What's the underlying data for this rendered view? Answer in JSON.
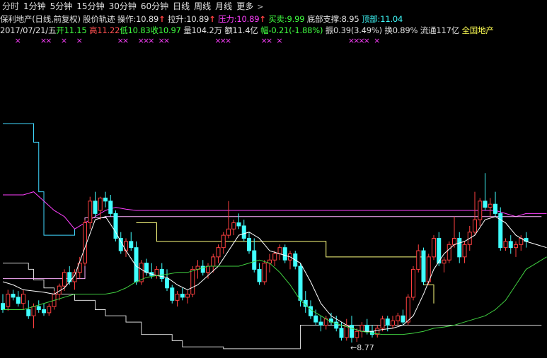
{
  "toolbar": {
    "periods": [
      "分时",
      "1分钟",
      "5分钟",
      "15分钟",
      "30分钟",
      "60分钟",
      "日线",
      "周线",
      "月线"
    ],
    "more_label": "更多",
    "more_arrow": ">"
  },
  "indicator": {
    "title": "保利地产(日线,前复权) 股价轨迹",
    "op_label": "操作:",
    "op_value": "10.89",
    "pull_label": "拉升:",
    "pull_value": "10.89",
    "pressure_label": "压力:",
    "pressure_value": "10.89",
    "buysell_label": "买卖:",
    "buysell_value": "9.99",
    "support_label": "底部支撑:",
    "support_value": "8.95",
    "top_label": "顶部:",
    "top_value": "11.04",
    "arrow": "↑"
  },
  "quote": {
    "date": "2017/07/21/五",
    "open_label": "开",
    "open": "11.15",
    "high_label": "高",
    "high": "11.22",
    "low_label": "低",
    "low": "10.83",
    "close_label": "收",
    "close": "10.97",
    "vol_label": "量",
    "vol": "104.2万",
    "amount_label": "额",
    "amount": "11.4亿",
    "change_label": "幅",
    "change": "-0.21(-1.88%)",
    "amp_label": "振",
    "amp": "0.39(3.49%)",
    "turnover_label": "换",
    "turnover": "0.89%",
    "float_label": "流通",
    "float": "117亿",
    "name": "全国地产"
  },
  "marker_glyph": "×",
  "annotation": {
    "low_text": "←8.77"
  },
  "colors": {
    "up": "#ff4040",
    "down": "#40ffff",
    "cyan_line": "#40d8ff",
    "magenta": "#ff40ff",
    "yellow": "#ffff80",
    "green": "#40d040",
    "white": "#ffffff",
    "support": "#d8d8d8",
    "resistance": "#ffb0ff"
  },
  "chart_data": {
    "type": "candlestick",
    "price_range": [
      8.6,
      12.3
    ],
    "candles": [
      [
        9.4,
        9.55,
        9.25,
        9.3
      ],
      [
        9.35,
        9.62,
        9.28,
        9.55
      ],
      [
        9.55,
        9.62,
        9.45,
        9.5
      ],
      [
        9.5,
        9.6,
        9.35,
        9.4
      ],
      [
        9.4,
        9.62,
        9.3,
        9.55
      ],
      [
        9.3,
        9.45,
        9.15,
        9.2
      ],
      [
        9.2,
        9.4,
        9.0,
        9.35
      ],
      [
        9.35,
        9.45,
        9.25,
        9.3
      ],
      [
        9.3,
        9.4,
        9.2,
        9.25
      ],
      [
        9.25,
        9.4,
        9.2,
        9.35
      ],
      [
        9.35,
        9.6,
        9.3,
        9.55
      ],
      [
        9.55,
        9.72,
        9.45,
        9.68
      ],
      [
        9.68,
        9.95,
        9.6,
        9.9
      ],
      [
        9.9,
        10.0,
        9.7,
        9.75
      ],
      [
        9.75,
        9.95,
        9.62,
        9.9
      ],
      [
        9.9,
        10.15,
        9.8,
        10.05
      ],
      [
        10.05,
        10.75,
        10.0,
        10.7
      ],
      [
        10.7,
        11.12,
        10.6,
        11.05
      ],
      [
        11.05,
        11.2,
        10.8,
        10.85
      ],
      [
        10.9,
        11.12,
        10.75,
        11.1
      ],
      [
        11.1,
        11.2,
        10.95,
        11.05
      ],
      [
        11.05,
        11.15,
        10.8,
        10.85
      ],
      [
        10.85,
        10.9,
        10.4,
        10.45
      ],
      [
        10.45,
        10.55,
        10.2,
        10.25
      ],
      [
        10.25,
        10.45,
        10.15,
        10.4
      ],
      [
        10.4,
        10.55,
        10.25,
        10.3
      ],
      [
        10.3,
        10.4,
        9.7,
        9.75
      ],
      [
        9.75,
        10.1,
        9.7,
        10.05
      ],
      [
        10.05,
        10.12,
        9.85,
        9.9
      ],
      [
        9.9,
        10.05,
        9.8,
        9.85
      ],
      [
        9.85,
        10.0,
        9.8,
        9.95
      ],
      [
        9.95,
        10.05,
        9.75,
        9.8
      ],
      [
        9.8,
        9.95,
        9.6,
        9.65
      ],
      [
        9.65,
        9.7,
        9.4,
        9.45
      ],
      [
        9.45,
        9.6,
        9.35,
        9.55
      ],
      [
        9.55,
        9.65,
        9.45,
        9.5
      ],
      [
        9.5,
        9.62,
        9.4,
        9.55
      ],
      [
        9.55,
        10.0,
        9.5,
        9.95
      ],
      [
        9.95,
        10.1,
        9.8,
        10.0
      ],
      [
        10.0,
        10.1,
        9.85,
        9.9
      ],
      [
        9.9,
        10.05,
        9.8,
        10.0
      ],
      [
        10.0,
        10.2,
        9.9,
        10.15
      ],
      [
        10.15,
        10.35,
        10.05,
        10.3
      ],
      [
        10.3,
        10.55,
        10.2,
        10.5
      ],
      [
        10.5,
        11.05,
        10.45,
        10.6
      ],
      [
        10.6,
        10.75,
        10.5,
        10.7
      ],
      [
        10.7,
        10.85,
        10.6,
        10.65
      ],
      [
        10.65,
        10.75,
        10.4,
        10.45
      ],
      [
        10.45,
        10.55,
        10.2,
        10.25
      ],
      [
        10.25,
        10.45,
        9.9,
        9.95
      ],
      [
        9.95,
        10.05,
        9.7,
        9.75
      ],
      [
        9.75,
        10.1,
        9.7,
        10.05
      ],
      [
        10.05,
        10.2,
        9.9,
        10.1
      ],
      [
        10.1,
        10.25,
        10.0,
        10.2
      ],
      [
        10.2,
        10.35,
        10.1,
        10.3
      ],
      [
        10.3,
        10.35,
        10.05,
        10.1
      ],
      [
        10.1,
        10.25,
        9.95,
        10.2
      ],
      [
        10.2,
        10.25,
        9.95,
        10.0
      ],
      [
        10.0,
        10.05,
        9.35,
        9.45
      ],
      [
        9.45,
        9.6,
        9.25,
        9.35
      ],
      [
        9.35,
        9.45,
        9.15,
        9.2
      ],
      [
        9.2,
        9.3,
        9.05,
        9.1
      ],
      [
        9.1,
        9.2,
        8.95,
        9.05
      ],
      [
        9.05,
        9.2,
        8.98,
        9.15
      ],
      [
        9.15,
        9.25,
        9.05,
        9.1
      ],
      [
        9.1,
        9.2,
        8.95,
        9.0
      ],
      [
        9.0,
        9.1,
        8.8,
        8.85
      ],
      [
        8.85,
        9.15,
        8.8,
        9.05
      ],
      [
        9.05,
        9.2,
        8.77,
        8.85
      ],
      [
        8.85,
        9.0,
        8.78,
        8.95
      ],
      [
        8.95,
        9.1,
        8.85,
        9.05
      ],
      [
        9.05,
        9.15,
        8.9,
        8.95
      ],
      [
        8.95,
        9.05,
        8.85,
        8.9
      ],
      [
        8.9,
        9.05,
        8.85,
        9.0
      ],
      [
        9.0,
        9.2,
        8.95,
        9.15
      ],
      [
        9.15,
        9.2,
        8.95,
        9.05
      ],
      [
        9.05,
        9.2,
        9.0,
        9.12
      ],
      [
        9.12,
        9.25,
        9.05,
        9.2
      ],
      [
        9.2,
        9.3,
        9.05,
        9.1
      ],
      [
        9.1,
        9.55,
        9.05,
        9.5
      ],
      [
        9.5,
        10.0,
        9.45,
        9.95
      ],
      [
        9.95,
        10.35,
        9.9,
        10.25
      ],
      [
        10.25,
        10.3,
        9.7,
        9.75
      ],
      [
        9.75,
        10.2,
        9.7,
        10.15
      ],
      [
        10.15,
        10.5,
        10.1,
        10.45
      ],
      [
        10.45,
        10.55,
        10.0,
        10.05
      ],
      [
        10.05,
        10.15,
        9.9,
        10.1
      ],
      [
        10.1,
        10.4,
        10.05,
        10.35
      ],
      [
        10.35,
        10.8,
        10.3,
        10.45
      ],
      [
        10.45,
        10.55,
        10.05,
        10.15
      ],
      [
        10.15,
        10.4,
        10.05,
        10.35
      ],
      [
        10.35,
        10.65,
        10.25,
        10.55
      ],
      [
        10.55,
        11.2,
        10.5,
        10.75
      ],
      [
        10.75,
        11.1,
        10.65,
        11.05
      ],
      [
        11.05,
        11.5,
        10.9,
        10.95
      ],
      [
        10.95,
        11.1,
        10.8,
        11.0
      ],
      [
        11.0,
        11.2,
        10.8,
        10.85
      ],
      [
        10.85,
        10.95,
        10.25,
        10.3
      ],
      [
        10.3,
        10.45,
        10.25,
        10.4
      ],
      [
        10.4,
        10.5,
        10.2,
        10.3
      ],
      [
        10.3,
        10.4,
        10.15,
        10.35
      ],
      [
        10.35,
        10.5,
        10.25,
        10.45
      ],
      [
        10.45,
        10.55,
        10.3,
        10.4
      ]
    ],
    "lines": {
      "support": [
        [
          0,
          10.05
        ],
        [
          4,
          10.05
        ],
        [
          5,
          9.95
        ],
        [
          6,
          9.78
        ],
        [
          8,
          9.65
        ],
        [
          10,
          9.55
        ],
        [
          14,
          9.45
        ],
        [
          18,
          9.3
        ],
        [
          20,
          9.2
        ],
        [
          24,
          9.1
        ],
        [
          27,
          8.9
        ],
        [
          33,
          8.8
        ],
        [
          34,
          8.8
        ],
        [
          35,
          8.7
        ],
        [
          36,
          8.7
        ],
        [
          40,
          8.7
        ],
        [
          43,
          8.67
        ],
        [
          44,
          8.67
        ],
        [
          45,
          8.67
        ],
        [
          47,
          8.67
        ],
        [
          48,
          8.67
        ],
        [
          49,
          8.67
        ],
        [
          52,
          8.67
        ],
        [
          53,
          8.67
        ],
        [
          55,
          8.67
        ],
        [
          57,
          8.67
        ],
        [
          58,
          9.05
        ],
        [
          62,
          9.05
        ],
        [
          69,
          9.05
        ],
        [
          80,
          9.05
        ],
        [
          90,
          9.05
        ],
        [
          100,
          9.05
        ],
        [
          103,
          9.05
        ],
        [
          105,
          9.05
        ]
      ],
      "upper": [
        [
          26,
          10.7
        ],
        [
          30,
          10.4
        ],
        [
          34,
          10.4
        ],
        [
          36,
          10.4
        ],
        [
          40,
          10.4
        ],
        [
          44,
          10.4
        ],
        [
          48,
          10.4
        ],
        [
          52,
          10.4
        ],
        [
          56,
          10.4
        ],
        [
          60,
          10.4
        ],
        [
          63,
          10.15
        ],
        [
          64,
          10.15
        ],
        [
          68,
          10.15
        ],
        [
          72,
          10.15
        ],
        [
          76,
          10.15
        ],
        [
          80,
          10.15
        ],
        [
          82,
          9.7
        ],
        [
          84,
          9.4
        ]
      ],
      "resistance": [
        [
          0,
          9.8
        ],
        [
          12,
          9.8
        ],
        [
          14,
          9.8
        ],
        [
          16,
          10.78
        ],
        [
          20,
          10.8
        ],
        [
          30,
          10.8
        ],
        [
          40,
          10.8
        ],
        [
          50,
          10.8
        ],
        [
          60,
          10.8
        ],
        [
          70,
          10.8
        ],
        [
          80,
          10.8
        ],
        [
          90,
          10.8
        ],
        [
          100,
          10.8
        ],
        [
          105,
          10.8
        ]
      ],
      "magenta": [
        [
          0,
          11.15
        ],
        [
          4,
          11.15
        ],
        [
          6,
          11.2
        ],
        [
          8,
          11.05
        ],
        [
          10,
          10.9
        ],
        [
          12,
          10.8
        ],
        [
          14,
          10.6
        ],
        [
          16,
          10.7
        ],
        [
          18,
          10.8
        ],
        [
          20,
          10.9
        ],
        [
          22,
          10.95
        ],
        [
          24,
          10.92
        ],
        [
          26,
          10.9
        ],
        [
          30,
          10.9
        ],
        [
          40,
          10.9
        ],
        [
          50,
          10.9
        ],
        [
          60,
          10.9
        ],
        [
          70,
          10.9
        ],
        [
          80,
          10.9
        ],
        [
          90,
          10.9
        ],
        [
          96,
          10.9
        ],
        [
          98,
          10.85
        ],
        [
          100,
          10.8
        ],
        [
          102,
          10.85
        ],
        [
          104,
          10.85
        ],
        [
          106,
          10.85
        ]
      ],
      "cyan": [
        [
          0,
          12.3
        ],
        [
          5,
          12.3
        ],
        [
          6,
          12.0
        ],
        [
          7,
          11.2
        ],
        [
          8,
          10.5
        ],
        [
          9,
          10.5
        ],
        [
          10,
          10.5
        ],
        [
          12,
          10.5
        ],
        [
          13,
          10.5
        ],
        [
          14,
          10.6
        ]
      ],
      "white_ma": [
        [
          0,
          9.75
        ],
        [
          2,
          9.7
        ],
        [
          4,
          9.62
        ],
        [
          6,
          9.6
        ],
        [
          8,
          9.58
        ],
        [
          10,
          9.55
        ],
        [
          12,
          9.65
        ],
        [
          14,
          9.85
        ],
        [
          16,
          10.3
        ],
        [
          18,
          10.75
        ],
        [
          20,
          10.8
        ],
        [
          22,
          10.55
        ],
        [
          24,
          10.25
        ],
        [
          26,
          10.0
        ],
        [
          28,
          9.9
        ],
        [
          30,
          9.85
        ],
        [
          32,
          9.82
        ],
        [
          34,
          9.7
        ],
        [
          36,
          9.62
        ],
        [
          38,
          9.7
        ],
        [
          40,
          9.85
        ],
        [
          42,
          10.0
        ],
        [
          44,
          10.25
        ],
        [
          46,
          10.5
        ],
        [
          48,
          10.55
        ],
        [
          50,
          10.45
        ],
        [
          52,
          10.25
        ],
        [
          54,
          10.2
        ],
        [
          56,
          10.15
        ],
        [
          58,
          10.05
        ],
        [
          60,
          9.75
        ],
        [
          62,
          9.4
        ],
        [
          64,
          9.2
        ],
        [
          66,
          9.1
        ],
        [
          68,
          9.0
        ],
        [
          70,
          8.95
        ],
        [
          72,
          8.95
        ],
        [
          74,
          8.98
        ],
        [
          76,
          9.0
        ],
        [
          78,
          9.05
        ],
        [
          80,
          9.2
        ],
        [
          82,
          9.55
        ],
        [
          84,
          9.95
        ],
        [
          86,
          10.2
        ],
        [
          88,
          10.35
        ],
        [
          90,
          10.4
        ],
        [
          92,
          10.5
        ],
        [
          94,
          10.75
        ],
        [
          96,
          10.8
        ],
        [
          98,
          10.7
        ],
        [
          100,
          10.5
        ],
        [
          102,
          10.4
        ],
        [
          104,
          10.35
        ],
        [
          106,
          10.3
        ]
      ],
      "green_ma": [
        [
          0,
          9.3
        ],
        [
          4,
          9.3
        ],
        [
          8,
          9.4
        ],
        [
          10,
          9.45
        ],
        [
          12,
          9.5
        ],
        [
          14,
          9.55
        ],
        [
          16,
          9.55
        ],
        [
          18,
          9.55
        ],
        [
          20,
          9.55
        ],
        [
          22,
          9.58
        ],
        [
          24,
          9.65
        ],
        [
          26,
          9.75
        ],
        [
          28,
          9.82
        ],
        [
          30,
          9.85
        ],
        [
          32,
          9.87
        ],
        [
          34,
          9.9
        ],
        [
          36,
          9.9
        ],
        [
          38,
          9.95
        ],
        [
          40,
          10.0
        ],
        [
          42,
          10.0
        ],
        [
          44,
          10.0
        ],
        [
          46,
          10.0
        ],
        [
          48,
          10.05
        ],
        [
          50,
          10.1
        ],
        [
          52,
          10.05
        ],
        [
          54,
          9.9
        ],
        [
          56,
          9.7
        ],
        [
          58,
          9.45
        ],
        [
          60,
          9.3
        ],
        [
          62,
          9.2
        ],
        [
          64,
          9.1
        ],
        [
          66,
          9.05
        ],
        [
          68,
          9.0
        ],
        [
          70,
          8.95
        ],
        [
          72,
          8.92
        ],
        [
          74,
          8.9
        ],
        [
          76,
          8.9
        ],
        [
          78,
          8.9
        ],
        [
          80,
          8.92
        ],
        [
          82,
          8.95
        ],
        [
          84,
          9.0
        ],
        [
          86,
          9.02
        ],
        [
          88,
          9.05
        ],
        [
          90,
          9.1
        ],
        [
          92,
          9.15
        ],
        [
          94,
          9.2
        ],
        [
          96,
          9.3
        ],
        [
          98,
          9.45
        ],
        [
          100,
          9.7
        ],
        [
          102,
          9.95
        ],
        [
          104,
          10.05
        ],
        [
          106,
          10.15
        ]
      ]
    },
    "markers_x": [
      1,
      6,
      7,
      10,
      13,
      21,
      22,
      25,
      26,
      27,
      29,
      30,
      40,
      41,
      42,
      49,
      50,
      52,
      66,
      67,
      68,
      69,
      71
    ]
  }
}
